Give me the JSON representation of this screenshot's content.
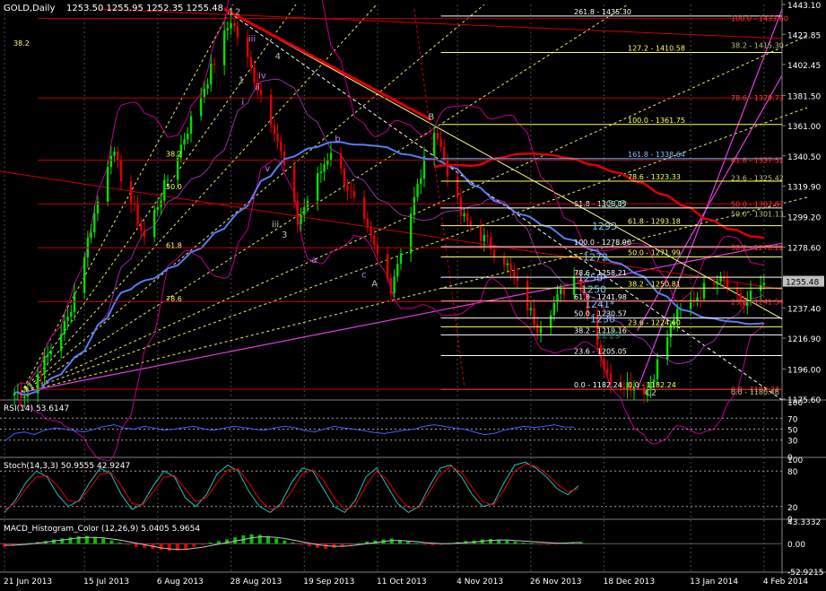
{
  "header": {
    "symbol_label": "GOLD,Daily",
    "ohlc_label": "1253.50 1255.95 1252.35 1255.48"
  },
  "colors": {
    "background": "#000000",
    "grid": "#4a4a4a",
    "up_candle": "#00e000",
    "down_candle": "#e00000",
    "ma_blue": "#5a7cf0",
    "ma_red": "#e00000",
    "bollinger": "#c0008c",
    "fib_line": "#ffff66",
    "trend_magenta": "#e040e0",
    "price_tag": "#c0c0c0"
  },
  "chart_data": [
    {
      "type": "line",
      "title": "GOLD,Daily",
      "price_axis_labels": [
        "1443.10",
        "1422.85",
        "1402.45",
        "1381.50",
        "1361.00",
        "1340.50",
        "1319.90",
        "1299.20",
        "1278.60",
        "1255.48",
        "1237.40",
        "1216.90",
        "1196.00",
        "1175.60"
      ],
      "current_price": "1255.48",
      "ylim": [
        1175.6,
        1443.1
      ],
      "date_labels": [
        "21 Jun 2013",
        "15 Jul 2013",
        "6 Aug 2013",
        "28 Aug 2013",
        "19 Sep 2013",
        "11 Oct 2013",
        "4 Nov 2013",
        "26 Nov 2013",
        "18 Dec 2013",
        "13 Jan 2014",
        "4 Feb 2014"
      ],
      "swing_points": [
        {
          "date": "2013-06-28",
          "price": 1180
        },
        {
          "date": "2013-07-10",
          "price": 1230
        },
        {
          "date": "2013-07-23",
          "price": 1345
        },
        {
          "date": "2013-08-02",
          "price": 1285
        },
        {
          "date": "2013-08-28",
          "price": 1433
        },
        {
          "date": "2013-09-10",
          "price": 1360
        },
        {
          "date": "2013-09-17",
          "price": 1296
        },
        {
          "date": "2013-09-27",
          "price": 1345
        },
        {
          "date": "2013-10-15",
          "price": 1252
        },
        {
          "date": "2013-10-28",
          "price": 1361
        },
        {
          "date": "2013-11-05",
          "price": 1300
        },
        {
          "date": "2013-11-18",
          "price": 1270
        },
        {
          "date": "2013-11-28",
          "price": 1225
        },
        {
          "date": "2013-12-10",
          "price": 1262
        },
        {
          "date": "2013-12-19",
          "price": 1190
        },
        {
          "date": "2013-12-31",
          "price": 1182
        },
        {
          "date": "2014-01-08",
          "price": 1230
        },
        {
          "date": "2014-01-22",
          "price": 1262
        },
        {
          "date": "2014-01-29",
          "price": 1240
        },
        {
          "date": "2014-02-04",
          "price": 1255
        }
      ],
      "fib_levels": [
        {
          "label": "261.8 - 1435.30",
          "price": 1435.3,
          "color": "#ffffff"
        },
        {
          "label": "127.2 - 1410.58",
          "price": 1410.58,
          "color": "#ffff66"
        },
        {
          "label": "100.0 - 1361.75",
          "price": 1361.75,
          "color": "#ffff66"
        },
        {
          "label": "161.8 - 1338.64",
          "price": 1338.64,
          "color": "#80c0ff"
        },
        {
          "label": "78.6 - 1323.33",
          "price": 1323.33,
          "color": "#ffff66"
        },
        {
          "label": "61.8 - 1305.19",
          "price": 1305.19,
          "color": "#ffffff"
        },
        {
          "label": "61.8 - 1293.18",
          "price": 1293.18,
          "color": "#ffff66"
        },
        {
          "label": "100.0 - 1278.90",
          "price": 1278.9,
          "color": "#ffffff"
        },
        {
          "label": "50.0 - 1271.99",
          "price": 1271.99,
          "color": "#ffff66"
        },
        {
          "label": "78.6 - 1258.21",
          "price": 1258.21,
          "color": "#ffffff"
        },
        {
          "label": "38.2 - 1250.81",
          "price": 1250.81,
          "color": "#ffff66"
        },
        {
          "label": "61.8 - 1241.98",
          "price": 1241.98,
          "color": "#ffffff"
        },
        {
          "label": "50.0 - 1230.57",
          "price": 1230.57,
          "color": "#ffffff"
        },
        {
          "label": "23.6 - 1224.60",
          "price": 1224.6,
          "color": "#ffff66"
        },
        {
          "label": "38.2 - 1219.16",
          "price": 1219.16,
          "color": "#ffffff"
        },
        {
          "label": "23.6 - 1205.05",
          "price": 1205.05,
          "color": "#ffffff"
        },
        {
          "label": "0.0 - 1182.24",
          "price": 1182.24,
          "color": "#ffffff"
        },
        {
          "label": "0.0 - 1182.24",
          "price": 1182.24,
          "color": "#ffff66"
        }
      ],
      "red_fib_levels": [
        {
          "label": "100.0 - 1433.60",
          "price": 1433.6
        },
        {
          "label": "78.6 - 1379.73",
          "price": 1379.73
        },
        {
          "label": "61.8 - 1337.52",
          "price": 1337.52
        },
        {
          "label": "50.0 - 1307.87",
          "price": 1307.87
        },
        {
          "label": "38.2 - 1278.22",
          "price": 1278.22
        },
        {
          "label": "23.6 - 1241.54",
          "price": 1241.54
        },
        {
          "label": "0.0 - 1182.24",
          "price": 1182.24
        }
      ],
      "olive_fib_levels": [
        {
          "label": "38.2 - 1415.30",
          "price": 1415.3
        },
        {
          "label": "23.6 - 1325.42",
          "price": 1325.42
        },
        {
          "label": "50.0 - 1301.13",
          "price": 1301.13
        },
        {
          "label": "0.0 - 1180.46",
          "price": 1180.46
        }
      ],
      "left_fib_labels": [
        {
          "label": "38.2",
          "price": 1415
        },
        {
          "label": "38.2",
          "price": 1340
        },
        {
          "label": "50.0",
          "price": 1318
        },
        {
          "label": "61.8",
          "price": 1278
        },
        {
          "label": "78.6",
          "price": 1242
        }
      ],
      "price_callouts": [
        {
          "label": "1308",
          "price": 1308,
          "color": "#40c0a0"
        },
        {
          "label": "1293",
          "price": 1293,
          "color": "#80c0ff"
        },
        {
          "label": "1272",
          "price": 1272,
          "color": "#80c0ff"
        },
        {
          "label": "1258*",
          "price": 1258,
          "color": "#80c0ff"
        },
        {
          "label": "1250",
          "price": 1250,
          "color": "#80c0ff"
        },
        {
          "label": "1241*",
          "price": 1240,
          "color": "#80c0ff"
        },
        {
          "label": "1230",
          "price": 1230,
          "color": "#80c0ff"
        },
        {
          "label": "1219",
          "price": 1219,
          "color": "#208060"
        }
      ],
      "wave_labels": [
        {
          "label": "1",
          "date": "2013-08-28",
          "price": 1436,
          "color": "#c0c0c0"
        },
        {
          "label": "2",
          "date": "2013-08-30",
          "price": 1436,
          "color": "#c0c0c0"
        },
        {
          "label": "iii",
          "date": "2013-09-03",
          "price": 1418,
          "color": "#c080ff"
        },
        {
          "label": "1",
          "date": "2013-08-31",
          "price": 1390,
          "color": "#c0c0c0"
        },
        {
          "label": "i",
          "date": "2013-09-01",
          "price": 1375,
          "color": "#c080ff"
        },
        {
          "label": "iv",
          "date": "2013-09-06",
          "price": 1393,
          "color": "#c080ff"
        },
        {
          "label": "4",
          "date": "2013-09-11",
          "price": 1406,
          "color": "#c0c0c0"
        },
        {
          "label": "ii",
          "date": "2013-09-05",
          "price": 1385,
          "color": "#c080ff"
        },
        {
          "label": "v",
          "date": "2013-09-08",
          "price": 1330,
          "color": "#c080ff"
        },
        {
          "label": "iii",
          "date": "2013-09-10",
          "price": 1292,
          "color": "#c0c0c0"
        },
        {
          "label": "3",
          "date": "2013-09-13",
          "price": 1285,
          "color": "#c0c0c0"
        },
        {
          "label": "a",
          "date": "2013-09-22",
          "price": 1268,
          "color": "#c080ff"
        },
        {
          "label": "b",
          "date": "2013-09-29",
          "price": 1350,
          "color": "#c080ff"
        },
        {
          "label": "c",
          "date": "2013-10-07",
          "price": 1258,
          "color": "#c080ff"
        },
        {
          "label": "A",
          "date": "2013-10-10",
          "price": 1252,
          "color": "#c0c0c0"
        },
        {
          "label": "B",
          "date": "2013-10-27",
          "price": 1365,
          "color": "#c0c0c0"
        },
        {
          "label": "C2",
          "date": "2013-12-31",
          "price": 1178,
          "color": "#c0c0c0"
        }
      ]
    },
    {
      "type": "line",
      "title": "RSI(14) 53.6147",
      "ylim": [
        0,
        100
      ],
      "levels": [
        70,
        50,
        30
      ],
      "axis_labels": [
        "100",
        "70",
        "50",
        "30",
        "0"
      ],
      "values": [
        28,
        42,
        45,
        40,
        48,
        52,
        50,
        47,
        45,
        50,
        55,
        58,
        52,
        50,
        55,
        52,
        48,
        50,
        53,
        55,
        50,
        48,
        52,
        55,
        53,
        50,
        48,
        52,
        55,
        53,
        48,
        45,
        50,
        55,
        52,
        50,
        47,
        44,
        42,
        45,
        48,
        50,
        55,
        58,
        55,
        52,
        50,
        45,
        40,
        42,
        48,
        52,
        55,
        53,
        55,
        58,
        54,
        53.6
      ]
    },
    {
      "type": "line",
      "title": "Stoch(14,3,3) 50.9555 42.9247",
      "ylim": [
        0,
        100
      ],
      "levels": [
        80,
        20
      ],
      "axis_labels": [
        "100",
        "80",
        "20",
        "0"
      ],
      "k_values": [
        10,
        30,
        60,
        80,
        70,
        40,
        20,
        30,
        60,
        85,
        75,
        40,
        15,
        25,
        55,
        80,
        70,
        35,
        20,
        40,
        75,
        90,
        80,
        45,
        20,
        10,
        25,
        60,
        85,
        80,
        50,
        20,
        10,
        30,
        70,
        85,
        55,
        25,
        10,
        20,
        55,
        85,
        90,
        70,
        40,
        20,
        25,
        60,
        90,
        95,
        85,
        70,
        50,
        40,
        55
      ],
      "d_values": [
        15,
        25,
        50,
        70,
        72,
        55,
        30,
        28,
        50,
        75,
        78,
        55,
        25,
        22,
        45,
        70,
        72,
        50,
        28,
        35,
        60,
        82,
        83,
        60,
        32,
        15,
        20,
        45,
        75,
        82,
        65,
        35,
        15,
        22,
        55,
        80,
        65,
        38,
        18,
        18,
        45,
        75,
        88,
        78,
        52,
        28,
        22,
        48,
        80,
        92,
        88,
        75,
        58,
        45,
        50
      ]
    },
    {
      "type": "bar",
      "title": "MACD_Histogram_Color (12,26,9) 5.0405 5.9654",
      "ylim": [
        -52.9215,
        43.3332
      ],
      "axis_labels": [
        "43.3332",
        "0.00",
        "-52.9215"
      ],
      "histogram": [
        -6,
        -4,
        -2,
        1,
        3,
        5,
        8,
        10,
        12,
        14,
        15,
        13,
        10,
        6,
        2,
        -2,
        -6,
        -8,
        -10,
        -12,
        -14,
        -13,
        -10,
        -6,
        -2,
        2,
        5,
        8,
        12,
        16,
        18,
        17,
        14,
        10,
        6,
        2,
        -2,
        -5,
        -8,
        -10,
        -8,
        -5,
        -2,
        1,
        4,
        6,
        8,
        10,
        7,
        4,
        1,
        -2,
        -3,
        -2,
        1,
        3,
        5,
        6,
        8,
        9,
        8,
        6,
        4,
        2,
        1,
        -1,
        -2,
        -1,
        1,
        2,
        3
      ],
      "signal": [
        -3,
        -3,
        -2,
        -1,
        1,
        3,
        5,
        7,
        9,
        11,
        12,
        12,
        11,
        9,
        7,
        4,
        1,
        -2,
        -5,
        -8,
        -10,
        -11,
        -11,
        -9,
        -7,
        -4,
        -1,
        2,
        5,
        8,
        11,
        13,
        13,
        12,
        10,
        7,
        4,
        1,
        -2,
        -4,
        -5,
        -5,
        -4,
        -2,
        0,
        2,
        4,
        6,
        6,
        5,
        4,
        2,
        1,
        0,
        0,
        1,
        2,
        3,
        5,
        6,
        7,
        7,
        6,
        5,
        4,
        3,
        2,
        1,
        1,
        2,
        2
      ]
    }
  ]
}
